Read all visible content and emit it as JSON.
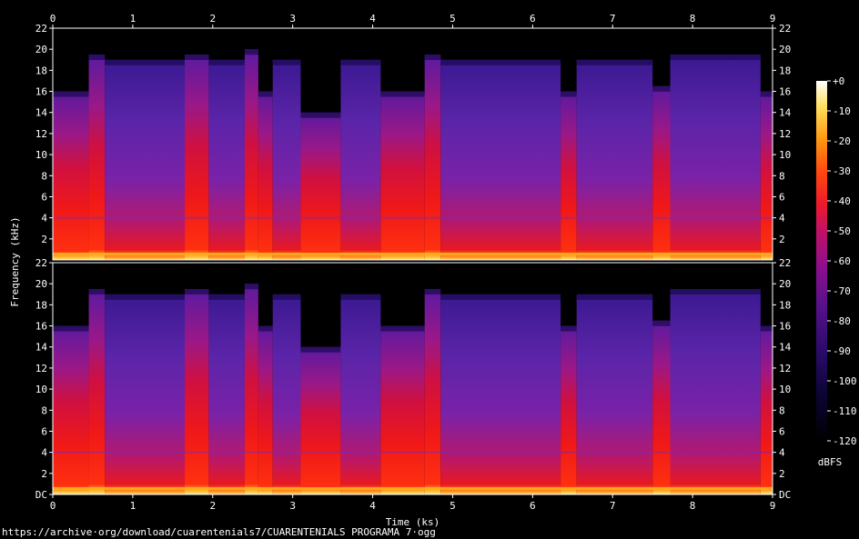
{
  "source_url": "https://archive·org/download/cuarentenials7/CUARENTENIALS PROGRAMA 7·ogg",
  "chart_data": {
    "type": "heatmap",
    "channels": 2,
    "xlabel": "Time (ks)",
    "ylabel": "Frequency (kHz)",
    "xlim": [
      0,
      9
    ],
    "ylim": [
      0,
      22
    ],
    "x_ticks": [
      "0",
      "1",
      "2",
      "3",
      "4",
      "5",
      "6",
      "7",
      "8",
      "9"
    ],
    "y_ticks_top": [
      "2",
      "4",
      "6",
      "8",
      "10",
      "12",
      "14",
      "16",
      "18",
      "20",
      "22"
    ],
    "y_ticks_bottom": [
      "DC",
      "2",
      "4",
      "6",
      "8",
      "10",
      "12",
      "14",
      "16",
      "18",
      "20",
      "22"
    ],
    "colorbar": {
      "label": "dBFS",
      "ticks": [
        "+0",
        "-10",
        "-20",
        "-30",
        "-40",
        "-50",
        "-60",
        "-70",
        "-80",
        "-90",
        "-100",
        "-110",
        "-120"
      ],
      "range": [
        -120,
        0
      ]
    },
    "segments": [
      {
        "t0": 0.0,
        "t1": 0.45,
        "cutoff_khz": 16.0,
        "level": "loud"
      },
      {
        "t0": 0.45,
        "t1": 0.65,
        "cutoff_khz": 19.5,
        "level": "loud"
      },
      {
        "t0": 0.65,
        "t1": 1.65,
        "cutoff_khz": 19.0,
        "level": "quiet"
      },
      {
        "t0": 1.65,
        "t1": 1.95,
        "cutoff_khz": 19.5,
        "level": "loud"
      },
      {
        "t0": 1.95,
        "t1": 2.4,
        "cutoff_khz": 19.0,
        "level": "quiet"
      },
      {
        "t0": 2.4,
        "t1": 2.57,
        "cutoff_khz": 20.0,
        "level": "loud"
      },
      {
        "t0": 2.57,
        "t1": 2.75,
        "cutoff_khz": 16.0,
        "level": "loud"
      },
      {
        "t0": 2.75,
        "t1": 3.1,
        "cutoff_khz": 19.0,
        "level": "quiet"
      },
      {
        "t0": 3.1,
        "t1": 3.6,
        "cutoff_khz": 14.0,
        "level": "loud"
      },
      {
        "t0": 3.6,
        "t1": 4.1,
        "cutoff_khz": 19.0,
        "level": "quiet"
      },
      {
        "t0": 4.1,
        "t1": 4.65,
        "cutoff_khz": 16.0,
        "level": "loud"
      },
      {
        "t0": 4.65,
        "t1": 4.85,
        "cutoff_khz": 19.5,
        "level": "loud"
      },
      {
        "t0": 4.85,
        "t1": 6.35,
        "cutoff_khz": 19.0,
        "level": "quiet"
      },
      {
        "t0": 6.35,
        "t1": 6.55,
        "cutoff_khz": 16.0,
        "level": "loud"
      },
      {
        "t0": 6.55,
        "t1": 7.5,
        "cutoff_khz": 19.0,
        "level": "quiet"
      },
      {
        "t0": 7.5,
        "t1": 7.72,
        "cutoff_khz": 16.5,
        "level": "loud"
      },
      {
        "t0": 7.72,
        "t1": 8.85,
        "cutoff_khz": 19.5,
        "level": "quiet"
      },
      {
        "t0": 8.85,
        "t1": 9.0,
        "cutoff_khz": 16.0,
        "level": "loud"
      }
    ]
  }
}
